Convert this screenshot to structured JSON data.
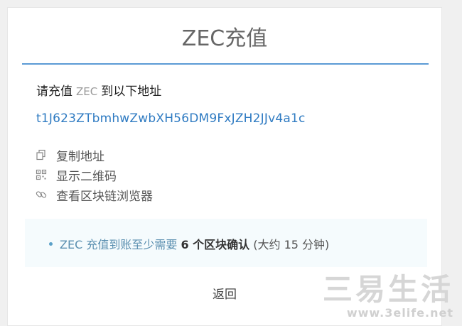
{
  "dialog": {
    "title": "ZEC充值",
    "instruction_prefix": "请充值",
    "instruction_coin": "ZEC",
    "instruction_suffix": "到以下地址",
    "address": "t1J623ZTbmhwZwbXH56DM9FxJZH2JJv4a1c",
    "actions": [
      {
        "icon": "copy-icon",
        "label": "复制地址"
      },
      {
        "icon": "qrcode-icon",
        "label": "显示二维码"
      },
      {
        "icon": "link-icon",
        "label": "查看区块链浏览器"
      }
    ],
    "notice": {
      "part1": "ZEC 充值到账至少需要",
      "part2": "6 个区块确认",
      "part3": "(大约 15 分钟)"
    },
    "back_label": "返回"
  },
  "watermark": {
    "logo_text": "三易生活",
    "url": "www.3elife.net"
  },
  "colors": {
    "accent_rule": "#5b9bd5",
    "address_link": "#2f7bc2",
    "notice_bg": "#f5fbfd"
  }
}
